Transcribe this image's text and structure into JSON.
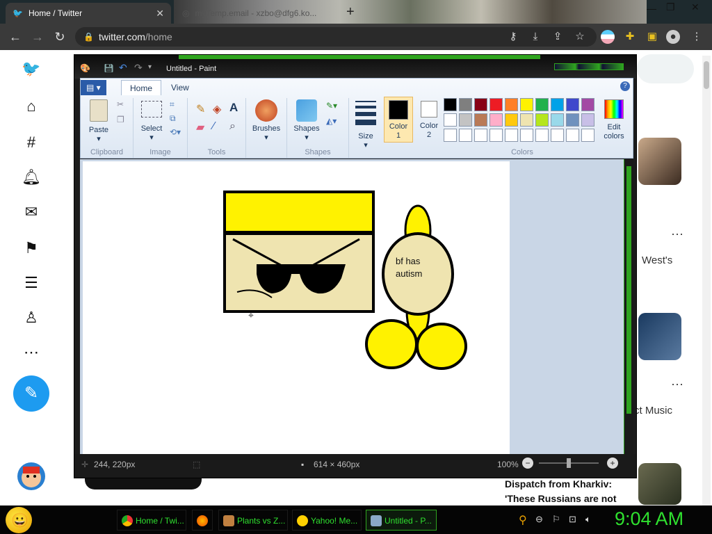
{
  "browser": {
    "tabs": [
      {
        "title": "Home / Twitter"
      },
      {
        "title": "myTemp.email - xzbo@dfg6.ko..."
      }
    ],
    "url_domain": "twitter.com",
    "url_path": "/home"
  },
  "twitter": {
    "nav": [
      "home-icon",
      "explore-icon",
      "notifications-icon",
      "messages-icon",
      "bookmarks-icon",
      "lists-icon",
      "profile-icon",
      "more-icon"
    ],
    "trends": [
      "West's",
      "ct Music"
    ],
    "news_headline_line1": "Dispatch from Kharkiv:",
    "news_headline_line2": "'These Russians are not",
    "accent": "#1d9bf0"
  },
  "paint": {
    "title": "Untitled - Paint",
    "tabs": [
      "Home",
      "View"
    ],
    "groups": {
      "clipboard": "Clipboard",
      "image": "Image",
      "tools": "Tools",
      "shapes": "Shapes",
      "colors": "Colors"
    },
    "buttons": {
      "paste": "Paste",
      "select": "Select",
      "brushes": "Brushes",
      "shapes": "Shapes",
      "size": "Size",
      "color1_line1": "Color",
      "color1_line2": "1",
      "color2_line1": "Color",
      "color2_line2": "2",
      "edit_colors_line1": "Edit",
      "edit_colors_line2": "colors"
    },
    "palette_row1": [
      "#000000",
      "#7f7f7f",
      "#880015",
      "#ed1c24",
      "#ff7f27",
      "#fff200",
      "#22b14c",
      "#00a2e8",
      "#3f48cc",
      "#a349a4"
    ],
    "palette_row2": [
      "#ffffff",
      "#c3c3c3",
      "#b97a57",
      "#ffaec9",
      "#ffc90e",
      "#efe4b0",
      "#b5e61d",
      "#99d9ea",
      "#7092be",
      "#c8bfe7"
    ],
    "drawing_text_line1": "bf has",
    "drawing_text_line2": "autism",
    "status": {
      "cursor_pos": "244, 220px",
      "canvas_size": "614 × 460px",
      "zoom": "100%"
    }
  },
  "taskbar": {
    "items": [
      "Home / Twi...",
      "Plants vs Z...",
      "Yahoo! Me...",
      "Untitled - P..."
    ],
    "clock": "9:04 AM"
  }
}
